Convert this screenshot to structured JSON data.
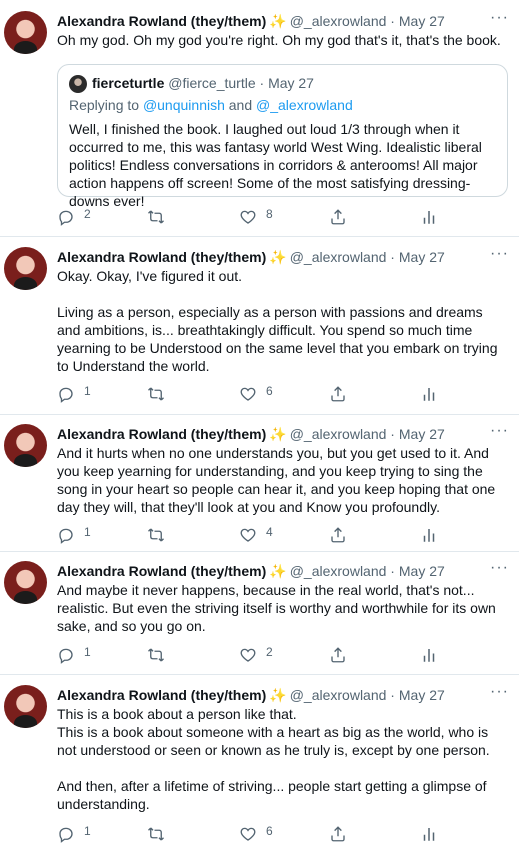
{
  "author": {
    "name": "Alexandra Rowland (they/them)",
    "emoji": "✨",
    "handle": "@_alexrowland",
    "date": "May 27"
  },
  "more_glyph": "···",
  "tweets": [
    {
      "text": [
        "Oh my god. Oh my god you're right. Oh my god that's it, that's the book."
      ],
      "replies": "2",
      "retweets": "",
      "likes": "8",
      "quote": {
        "name": "fierceturtle",
        "handle": "@fierce_turtle",
        "date": "May 27",
        "replying_prefix": "Replying to ",
        "replying_user1": "@unquinnish",
        "replying_and": " and ",
        "replying_user2": "@_alexrowland",
        "text": "Well, I finished the book. I laughed out loud 1/3 through when it occurred to me, this was fantasy world West Wing. Idealistic liberal politics! Endless conversations in corridors & anterooms! All major action happens off screen! Some of the most satisfying dressing-downs ever!"
      }
    },
    {
      "text": [
        "Okay. Okay, I've figured it out.",
        "",
        "Living as a person, especially as a person with passions and dreams and ambitions, is... breathtakingly difficult. You spend so much time yearning to be Understood on the same level that you embark on trying to Understand the world."
      ],
      "replies": "1",
      "retweets": "",
      "likes": "6"
    },
    {
      "text": [
        "And it hurts when no one understands you, but you get used to it. And you keep yearning for understanding, and you keep trying to sing the song in your heart so people can hear it, and you keep hoping that one day they will, that they'll look at you and Know you profoundly."
      ],
      "replies": "1",
      "retweets": "",
      "likes": "4"
    },
    {
      "text": [
        "And maybe it never happens, because in the real world, that's not... realistic. But even the striving itself is worthy and worthwhile for its own sake, and so you go on."
      ],
      "replies": "1",
      "retweets": "",
      "likes": "2"
    },
    {
      "text": [
        "This is a book about a person like that.",
        "This is a book about someone with a heart as big as the world, who is not understood or seen or known as he truly is, except by one person.",
        "",
        "And then, after a lifetime of striving... people start getting a glimpse of understanding."
      ],
      "replies": "1",
      "retweets": "",
      "likes": "6"
    }
  ]
}
